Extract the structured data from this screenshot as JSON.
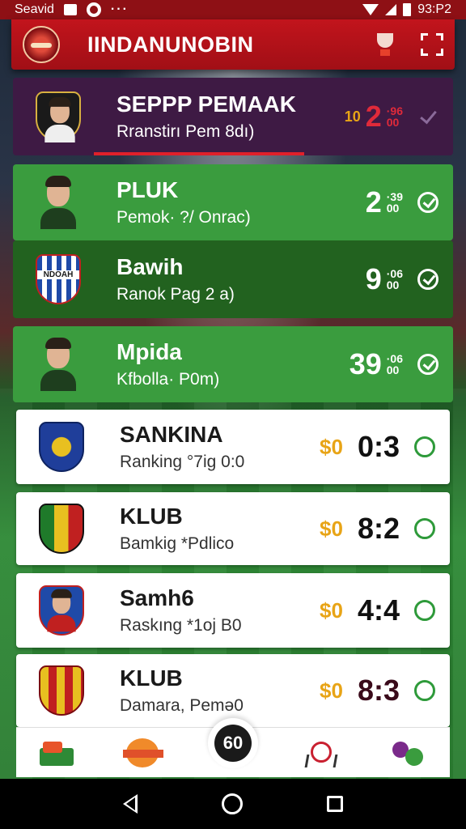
{
  "status_bar": {
    "carrier": "Seavid",
    "time": "93:P2"
  },
  "header": {
    "title": "IINDANUNOBIN"
  },
  "featured": {
    "name": "SEPPP PEMAAK",
    "subtitle": "Rranstirı Pem 8dı)",
    "prefix": "10",
    "score": "2",
    "score_small_top": "·96",
    "score_small_bottom": "00"
  },
  "rows": [
    {
      "name": "PLUK",
      "subtitle": "Pemok· ?/ Onrac)",
      "score": "2",
      "score_small_top": "·39",
      "score_small_bottom": "00",
      "coin": ""
    },
    {
      "name": "Bawih",
      "subtitle": "Ranok Pag 2 a)",
      "score": "9",
      "score_small_top": "·06",
      "score_small_bottom": "00",
      "coin": ""
    },
    {
      "name": "Mpida",
      "subtitle": "Kfbolla· P0m)",
      "score": "39",
      "score_small_top": "·06",
      "score_small_bottom": "00",
      "coin": ""
    },
    {
      "name": "SANKINA",
      "subtitle": "Ranking °7ig 0:0",
      "score": "0:3",
      "coin": "$0"
    },
    {
      "name": "KLUB",
      "subtitle": "Bamkig *Pdlico",
      "score": "8:2",
      "coin": "$0"
    },
    {
      "name": "Samh6",
      "subtitle": "Raskıng *1oj B0",
      "score": "4:4",
      "coin": "$0"
    },
    {
      "name": "KLUB",
      "subtitle": "Damara, Pemə0",
      "score": "8:3",
      "coin": "$0"
    }
  ],
  "badge_labels": {
    "club_bawih": "NDOAH"
  },
  "bottom_nav": {
    "center_label": "60"
  },
  "colors": {
    "header_red": "#c2141c",
    "featured_purple": "#3e1a44",
    "row_green": "#3a9c3e",
    "row_dark_green": "#22621f",
    "coin_gold": "#e8a416"
  },
  "icons": [
    "wifi-icon",
    "signal-icon",
    "battery-icon",
    "trophy-icon",
    "expand-icon",
    "check-circle-icon",
    "ring-icon",
    "back-icon",
    "home-icon",
    "recents-icon"
  ]
}
